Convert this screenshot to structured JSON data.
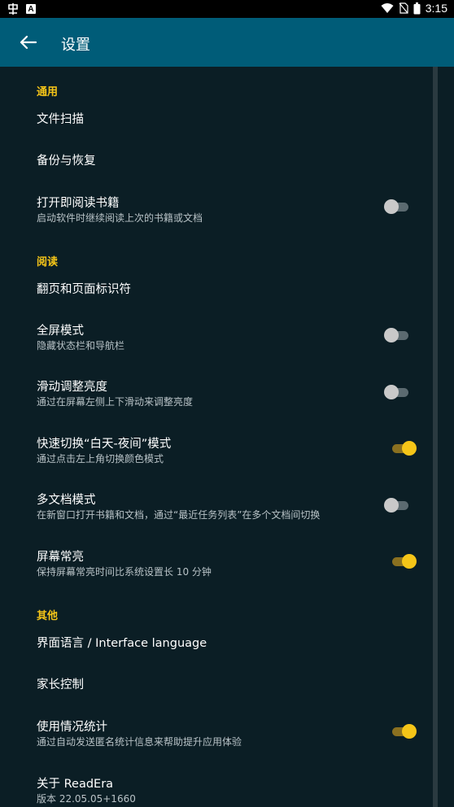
{
  "status_bar": {
    "time": "3:15",
    "app_icon_text": "A"
  },
  "app_bar": {
    "title": "设置"
  },
  "sections": [
    {
      "header": "通用"
    },
    {
      "header": "阅读"
    },
    {
      "header": "其他"
    }
  ],
  "items": [
    {
      "title": "文件扫描"
    },
    {
      "title": "备份与恢复"
    },
    {
      "title": "打开即阅读书籍",
      "subtitle": "启动软件时继续阅读上次的书籍或文档",
      "toggle": false
    },
    {
      "title": "翻页和页面标识符"
    },
    {
      "title": "全屏模式",
      "subtitle": "隐藏状态栏和导航栏",
      "toggle": false
    },
    {
      "title": "滑动调整亮度",
      "subtitle": "通过在屏幕左侧上下滑动来调整亮度",
      "toggle": false
    },
    {
      "title": "快速切换“白天-夜间”模式",
      "subtitle": "通过点击左上角切换颜色模式",
      "toggle": true
    },
    {
      "title": "多文档模式",
      "subtitle": "在新窗口打开书籍和文档，通过“最近任务列表”在多个文档间切换",
      "toggle": false
    },
    {
      "title": "屏幕常亮",
      "subtitle": "保持屏幕常亮时间比系统设置长 10 分钟",
      "toggle": true
    },
    {
      "title": "界面语言 / Interface language"
    },
    {
      "title": "家长控制"
    },
    {
      "title": "使用情况统计",
      "subtitle": "通过自动发送匿名统计信息来帮助提升应用体验",
      "toggle": true
    },
    {
      "title": "关于 ReadEra",
      "subtitle": "版本 22.05.05+1660"
    }
  ],
  "colors": {
    "app_bar": "#005c78",
    "background": "#0b1e25",
    "accent": "#f5c518"
  }
}
